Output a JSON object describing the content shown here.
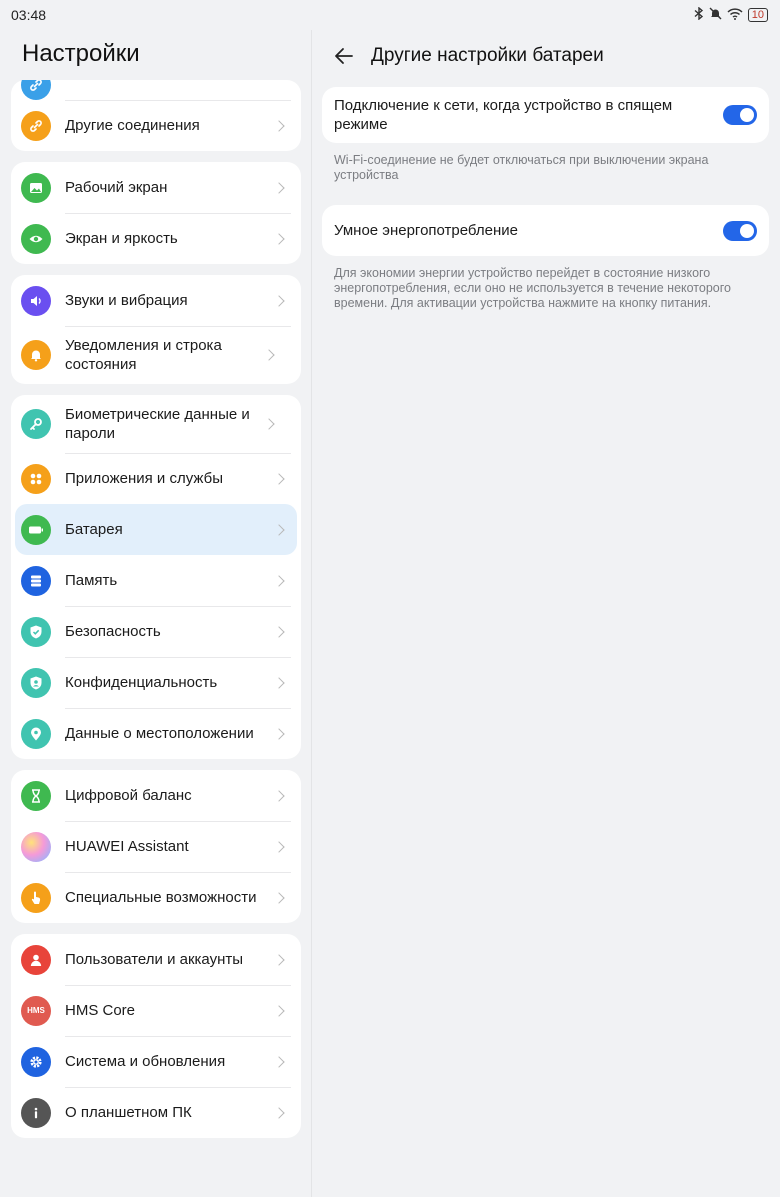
{
  "status": {
    "time": "03:48",
    "battery": "10"
  },
  "left": {
    "title": "Настройки",
    "groups": [
      {
        "items": [
          {
            "label": "",
            "icon": "link-icon",
            "color": "#3aa0e8"
          },
          {
            "label": "Другие соединения",
            "icon": "link-icon",
            "color": "#f5a01a"
          }
        ]
      },
      {
        "items": [
          {
            "label": "Рабочий экран",
            "icon": "image-icon",
            "color": "#3fb950"
          },
          {
            "label": "Экран и яркость",
            "icon": "eye-icon",
            "color": "#3fb950"
          }
        ]
      },
      {
        "items": [
          {
            "label": "Звуки и вибрация",
            "icon": "speaker-icon",
            "color": "#6a4ff0"
          },
          {
            "label": "Уведомления и строка состояния",
            "icon": "bell-icon",
            "color": "#f5a01a"
          }
        ]
      },
      {
        "items": [
          {
            "label": "Биометрические данные и пароли",
            "icon": "key-icon",
            "color": "#40c4b0"
          },
          {
            "label": "Приложения и службы",
            "icon": "apps-icon",
            "color": "#f5a01a"
          },
          {
            "label": "Батарея",
            "icon": "battery-icon",
            "color": "#3fb950",
            "active": true
          },
          {
            "label": "Память",
            "icon": "storage-icon",
            "color": "#1f63e0"
          },
          {
            "label": "Безопасность",
            "icon": "shield-icon",
            "color": "#40c4b0"
          },
          {
            "label": "Конфиденциальность",
            "icon": "privacy-icon",
            "color": "#40c4b0"
          },
          {
            "label": "Данные о местоположении",
            "icon": "location-icon",
            "color": "#40c4b0"
          }
        ]
      },
      {
        "items": [
          {
            "label": "Цифровой баланс",
            "icon": "hourglass-icon",
            "color": "#3fb950"
          },
          {
            "label": "HUAWEI Assistant",
            "icon": "assistant-icon",
            "color": "#e89ad0"
          },
          {
            "label": "Специальные возможности",
            "icon": "hand-icon",
            "color": "#f5a01a"
          }
        ]
      },
      {
        "items": [
          {
            "label": "Пользователи и аккаунты",
            "icon": "user-icon",
            "color": "#e8443a"
          },
          {
            "label": "HMS Core",
            "icon": "hms-icon",
            "color": "#e05a50",
            "badge": "HMS"
          },
          {
            "label": "Система и обновления",
            "icon": "gear-icon",
            "color": "#1f63e0"
          },
          {
            "label": "О планшетном ПК",
            "icon": "info-icon",
            "color": "#555555"
          }
        ]
      }
    ]
  },
  "right": {
    "title": "Другие настройки батареи",
    "option1": {
      "label": "Подключение к сети, когда устройство в спящем режиме",
      "desc": "Wi-Fi-соединение не будет отключаться при выключении экрана устройства"
    },
    "option2": {
      "label": "Умное энергопотребление",
      "desc": "Для экономии энергии устройство перейдет в состояние низкого энергопотребления, если оно не используется в течение некоторого времени. Для активации устройства нажмите на кнопку питания."
    },
    "accent": "#2366e8"
  }
}
